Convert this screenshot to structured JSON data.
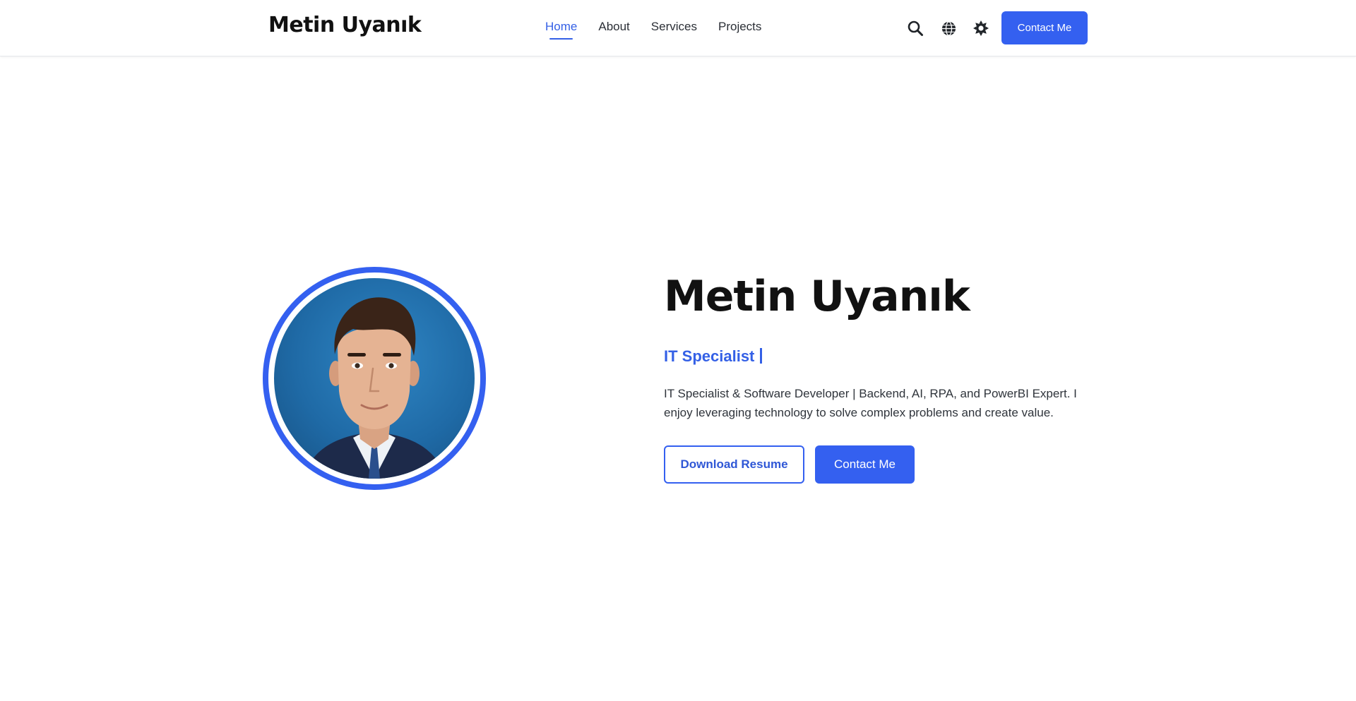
{
  "header": {
    "brand": "Metin Uyanık",
    "nav": [
      {
        "label": "Home",
        "active": true
      },
      {
        "label": "About",
        "active": false
      },
      {
        "label": "Services",
        "active": false
      },
      {
        "label": "Projects",
        "active": false
      }
    ],
    "icons": [
      "search-icon",
      "globe-icon",
      "theme-toggle-icon"
    ],
    "cta_label": "Contact Me"
  },
  "hero": {
    "title": "Metin Uyanık",
    "subtitle": "IT Specialist",
    "description": "IT Specialist & Software Developer | Backend, AI, RPA, and PowerBI Expert. I enjoy leveraging technology to solve complex problems and create value.",
    "primary_button": "Download Resume",
    "secondary_button": "Contact Me"
  },
  "colors": {
    "accent": "#3460f0",
    "text": "#111111",
    "background": "#ffffff"
  }
}
